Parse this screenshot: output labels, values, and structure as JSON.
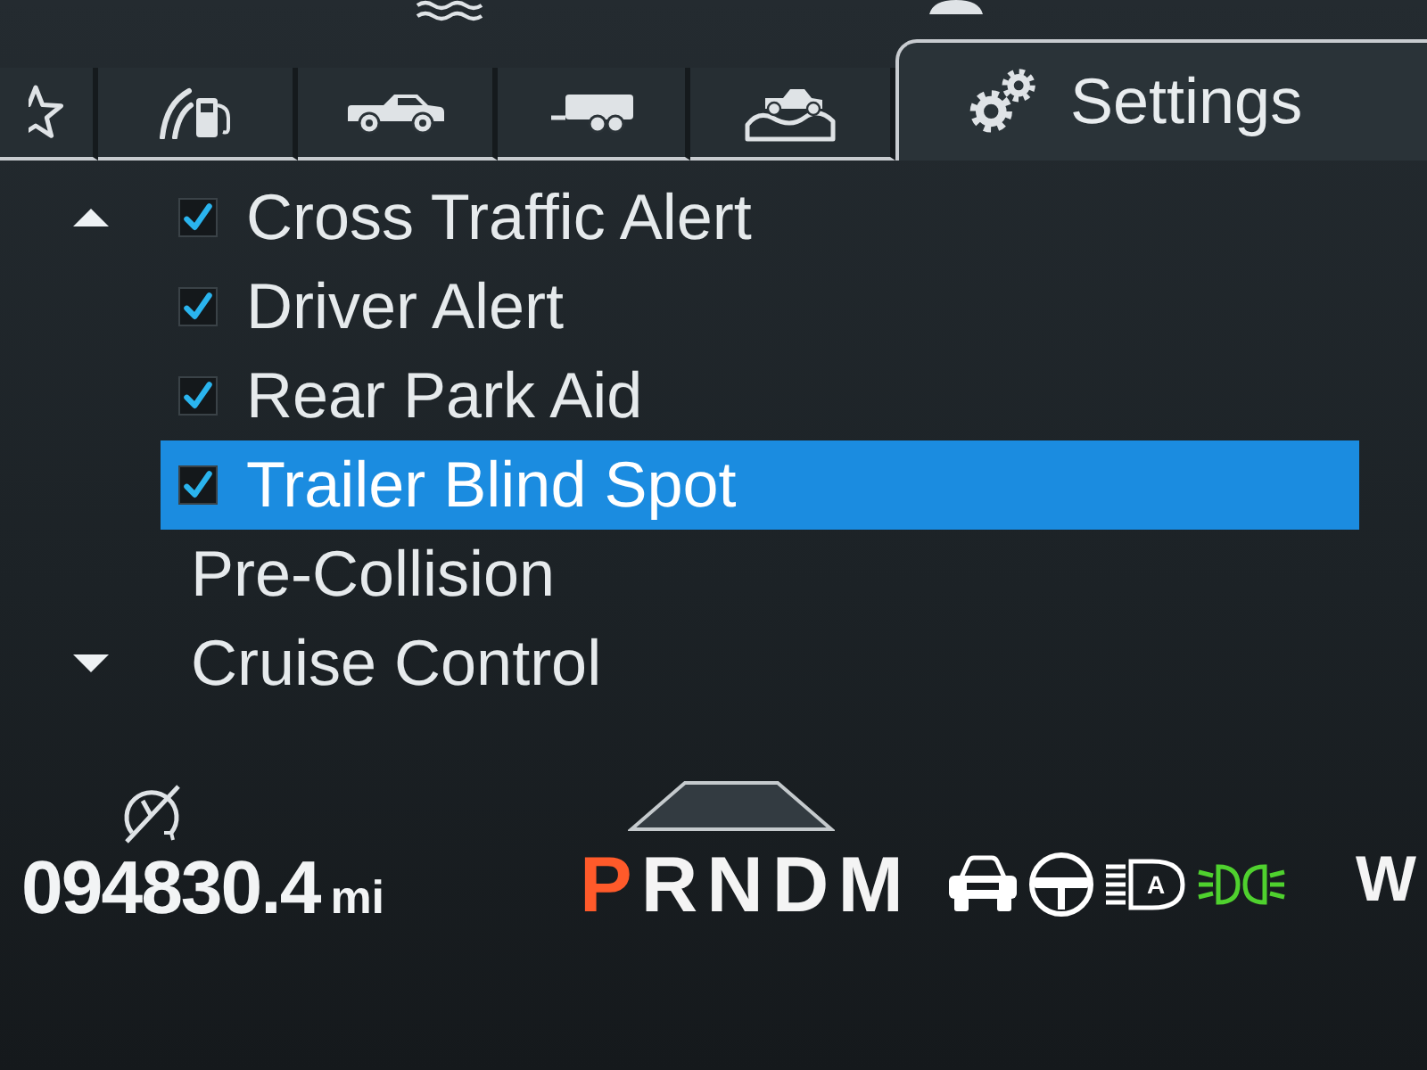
{
  "tabs": [
    {
      "selected": false
    },
    {
      "selected": false
    },
    {
      "selected": false
    },
    {
      "selected": false
    },
    {
      "selected": false
    },
    {
      "label": "Settings",
      "selected": true
    }
  ],
  "menu": {
    "items": [
      {
        "kind": "checkbox",
        "label": "Cross Traffic Alert",
        "checked": true,
        "selected": false
      },
      {
        "kind": "checkbox",
        "label": "Driver Alert",
        "checked": true,
        "selected": false
      },
      {
        "kind": "checkbox",
        "label": "Rear Park Aid",
        "checked": true,
        "selected": false
      },
      {
        "kind": "checkbox",
        "label": "Trailer Blind Spot",
        "checked": true,
        "selected": true
      },
      {
        "kind": "submenu",
        "label": "Pre-Collision",
        "selected": false
      },
      {
        "kind": "submenu",
        "label": "Cruise Control",
        "selected": false
      }
    ]
  },
  "odometer": {
    "value": "094830.4",
    "unit": "mi"
  },
  "gear_selector": [
    {
      "label": "P",
      "selected": true
    },
    {
      "label": "R",
      "selected": false
    },
    {
      "label": "N",
      "selected": false
    },
    {
      "label": "D",
      "selected": false
    },
    {
      "label": "M",
      "selected": false
    }
  ],
  "indicators": [
    {
      "color": "#ffffff"
    },
    {
      "color": "#ffffff"
    },
    {
      "color": "#ffffff",
      "label": "A"
    },
    {
      "color": "#4fd12e"
    }
  ],
  "compass": "W"
}
